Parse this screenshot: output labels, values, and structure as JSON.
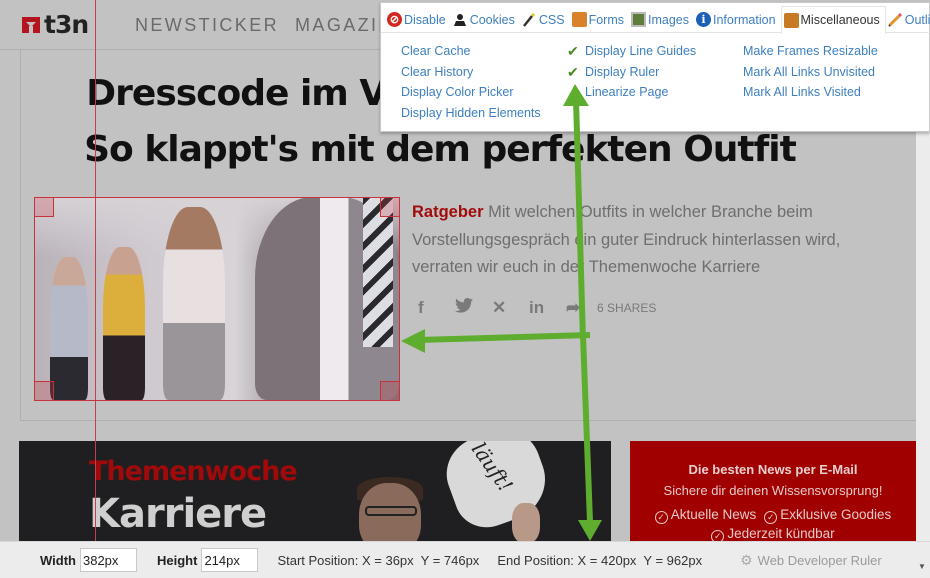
{
  "site": {
    "logo_text": "t3n",
    "nav": [
      "NEWSTICKER",
      "MAGAZIN"
    ],
    "headline": "Dresscode im Vorstellungsgespräch: So klappt's mit dem perfekten Outfit",
    "teaser": {
      "kicker": "Ratgeber",
      "text": "Mit welchen Outfits in welcher Branche beim Vorstellungsgespräch ein guter Eindruck hinterlassen wird, verraten wir euch in der Themenwoche Karriere"
    },
    "share": {
      "icons": [
        "facebook-icon",
        "twitter-icon",
        "xing-icon",
        "linkedin-icon",
        "share-icon"
      ],
      "glyphs": [
        "f",
        "🐦",
        "✕",
        "in",
        "➦"
      ],
      "count_label": "6 SHARES"
    },
    "promo_dark": {
      "title_red": "Themenwoche",
      "title_white": "Karriere",
      "bubble_text": "läuft!"
    },
    "promo_red": {
      "line1": "Die besten News per E-Mail",
      "line2": "Sichere dir deinen Wissensvorsprung!",
      "bullets": [
        "Aktuelle News",
        "Exklusive Goodies",
        "Jederzeit kündbar"
      ]
    }
  },
  "web_developer_menu": {
    "tabs": [
      {
        "label": "Disable",
        "icon": "disable-icon"
      },
      {
        "label": "Cookies",
        "icon": "cookies-icon"
      },
      {
        "label": "CSS",
        "icon": "css-icon"
      },
      {
        "label": "Forms",
        "icon": "forms-icon"
      },
      {
        "label": "Images",
        "icon": "images-icon"
      },
      {
        "label": "Information",
        "icon": "information-icon"
      },
      {
        "label": "Miscellaneous",
        "icon": "miscellaneous-icon",
        "active": true
      },
      {
        "label": "Outline",
        "icon": "outline-icon"
      }
    ],
    "columns": [
      [
        {
          "label": "Clear Cache",
          "checked": false
        },
        {
          "label": "Clear History",
          "checked": false
        },
        {
          "label": "Display Color Picker",
          "checked": false
        },
        {
          "label": "Display Hidden Elements",
          "checked": false
        }
      ],
      [
        {
          "label": "Display Line Guides",
          "checked": true
        },
        {
          "label": "Display Ruler",
          "checked": true
        },
        {
          "label": "Linearize Page",
          "checked": false
        }
      ],
      [
        {
          "label": "Make Frames Resizable",
          "checked": false
        },
        {
          "label": "Mark All Links Unvisited",
          "checked": false
        },
        {
          "label": "Mark All Links Visited",
          "checked": false
        }
      ]
    ]
  },
  "ruler_bar": {
    "width_label": "Width",
    "width_value": "382px",
    "height_label": "Height",
    "height_value": "214px",
    "start_position": "Start Position: X = 36px  Y = 746px",
    "end_position": "End Position: X = 420px  Y = 962px",
    "brand": "Web Developer Ruler"
  },
  "colors": {
    "accent_green": "#5fad2e",
    "ruler_red": "#c8323a",
    "link_blue": "#3d7fbf",
    "brand_red": "#a10000"
  }
}
